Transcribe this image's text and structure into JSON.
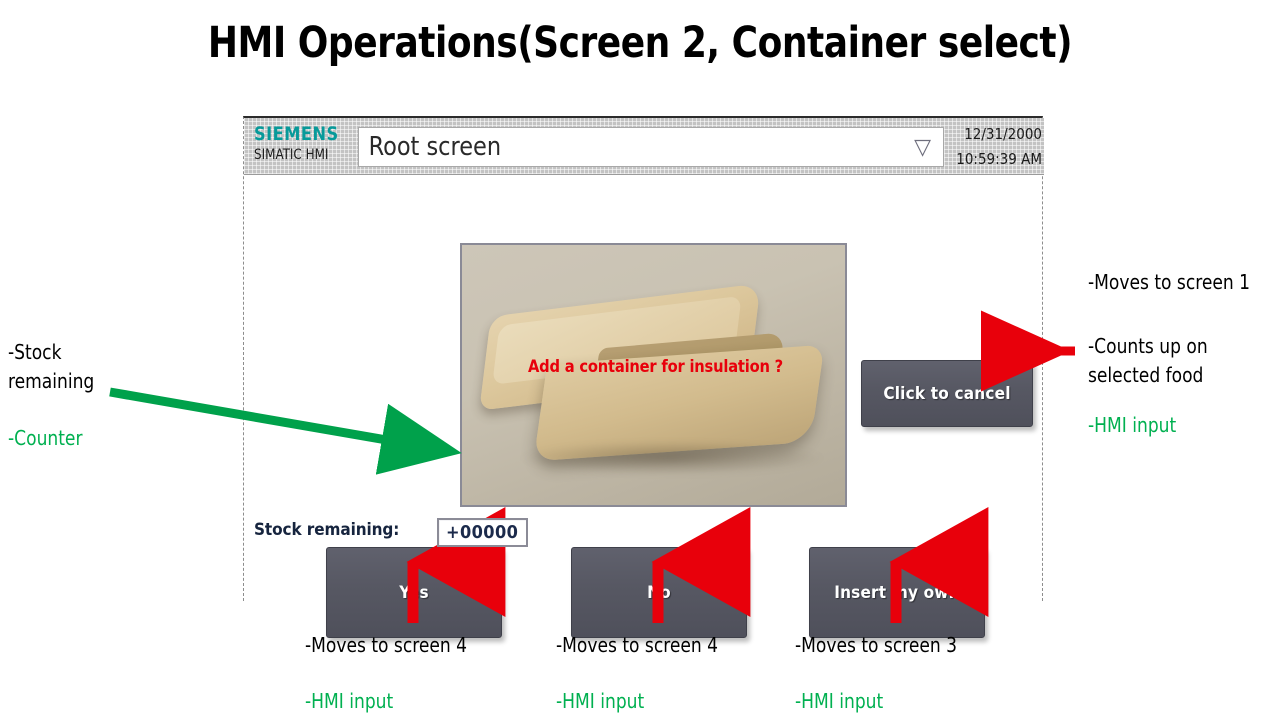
{
  "slide": {
    "title": "HMI Operations(Screen 2, Container select)"
  },
  "hmi": {
    "brand": {
      "logo": "SIEMENS",
      "subtitle": "SIMATIC HMI"
    },
    "screen_selector": {
      "value": "Root screen",
      "dropdown_icon": "chevron-down-outline-icon"
    },
    "clock": {
      "date": "12/31/2000",
      "time": "10:59:39 AM"
    },
    "photo": {
      "alt": "molded fiber food container with lid",
      "overlay_text": "Add a container for insulation ?",
      "overlay_color": "#e8000b"
    },
    "counter": {
      "label": "Stock remaining:",
      "value": "+00000"
    },
    "buttons": [
      {
        "id": "cancel",
        "label": "Click to cancel"
      },
      {
        "id": "yes",
        "label": "Yes"
      },
      {
        "id": "no",
        "label": "No"
      },
      {
        "id": "insert",
        "label": "Insert my own"
      }
    ]
  },
  "annotations": {
    "colors": {
      "black": "#000000",
      "green": "#00b050",
      "red_arrow": "#e8000b",
      "green_arrow": "#00a14b"
    },
    "left": {
      "stock": "-Stock\nremaining",
      "counter": "-Counter"
    },
    "right": {
      "screen1": "-Moves to screen 1",
      "counts": "-Counts up on\nselected food",
      "hmi_input": "-HMI input"
    },
    "bottom": {
      "yes_target": "-Moves to screen 4",
      "yes_input": "-HMI input",
      "no_target": "-Moves to screen 4",
      "no_input": "-HMI input",
      "insert_target": "-Moves to screen 3",
      "insert_input": "-HMI input"
    }
  }
}
